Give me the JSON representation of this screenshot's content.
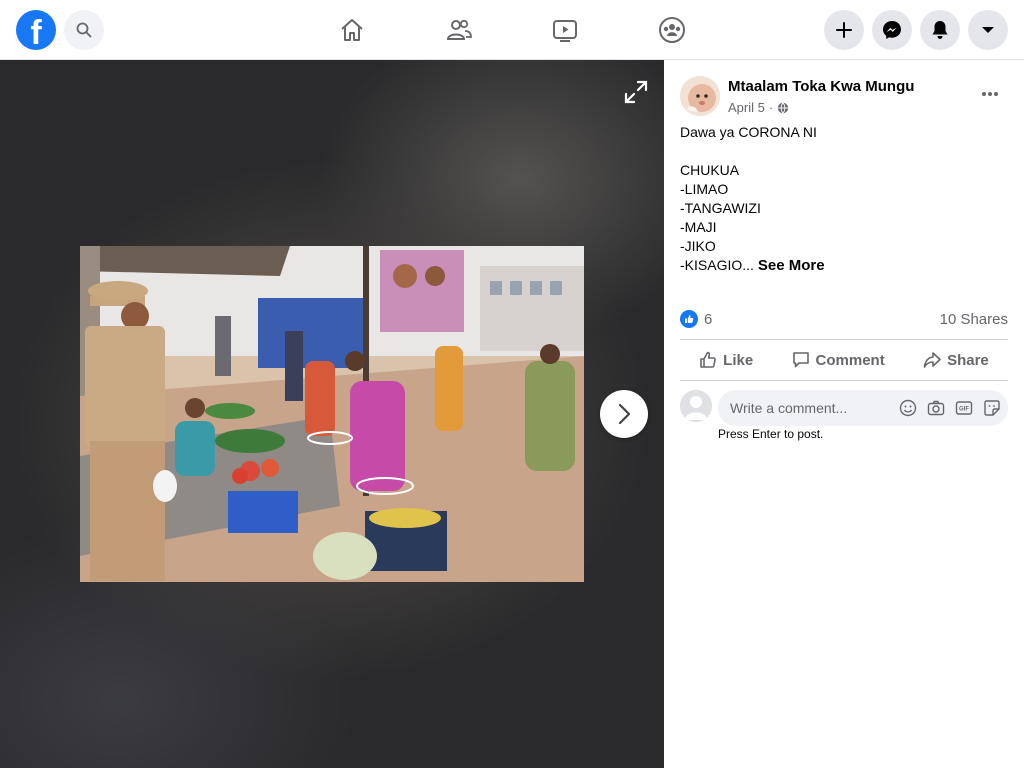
{
  "topbar": {
    "logo_letter": "f",
    "nav": [
      "home-icon",
      "friends-icon",
      "watch-icon",
      "groups-icon"
    ],
    "actions": [
      "plus-icon",
      "messenger-icon",
      "notifications-icon",
      "account-menu-icon"
    ]
  },
  "post": {
    "author": "Mtaalam Toka Kwa Mungu",
    "date": "April 5",
    "separator": "·",
    "privacy_icon": "globe-icon",
    "text_lines": [
      "Dawa ya CORONA NI",
      "",
      "CHUKUA",
      "-LIMAO",
      "-TANGAWIZI",
      "-MAJI",
      "-JIKO",
      "-KISAGIO..."
    ],
    "see_more": "See More",
    "reaction_count": "6",
    "shares": "10 Shares"
  },
  "actions": {
    "like": "Like",
    "comment": "Comment",
    "share": "Share"
  },
  "comment": {
    "placeholder": "Write a comment...",
    "hint": "Press Enter to post.",
    "icons": [
      "emoji-icon",
      "camera-icon",
      "gif-icon",
      "sticker-icon"
    ]
  },
  "colors": {
    "brand": "#1877f2",
    "text": "#050505",
    "secondary_text": "#65676b",
    "viewer_bg": "#2a2a2c"
  }
}
